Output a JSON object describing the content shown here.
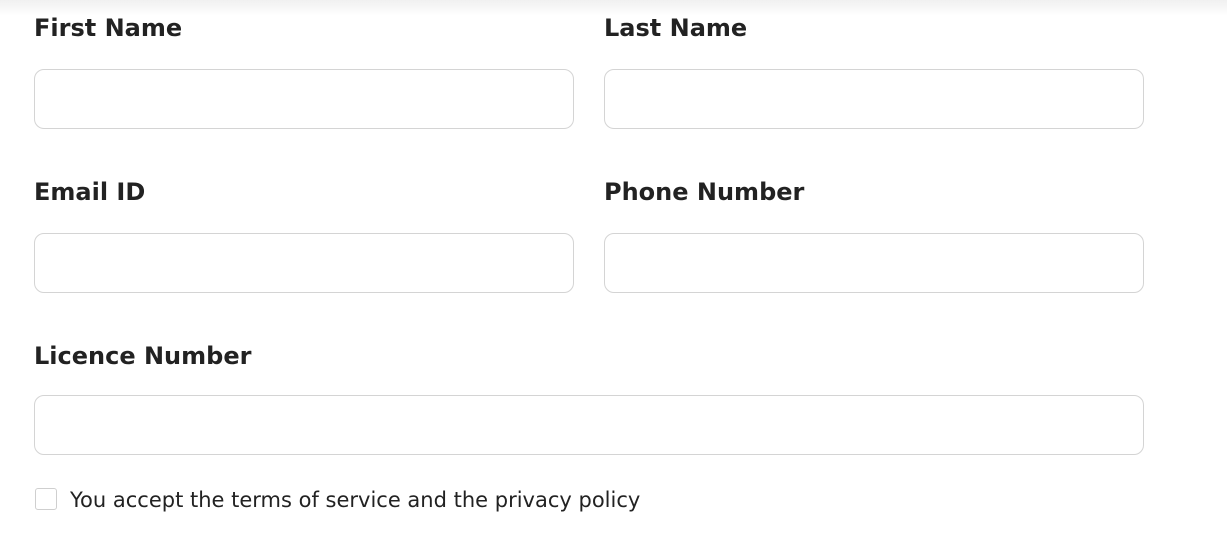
{
  "form": {
    "first_name": {
      "label": "First Name",
      "value": "",
      "placeholder": ""
    },
    "last_name": {
      "label": "Last Name",
      "value": "",
      "placeholder": ""
    },
    "email": {
      "label": "Email ID",
      "value": "",
      "placeholder": ""
    },
    "phone": {
      "label": "Phone Number",
      "value": "",
      "placeholder": ""
    },
    "licence": {
      "label": "Licence Number",
      "value": "",
      "placeholder": ""
    },
    "terms": {
      "label": "You accept the terms of service and the privacy policy",
      "checked": false
    }
  }
}
